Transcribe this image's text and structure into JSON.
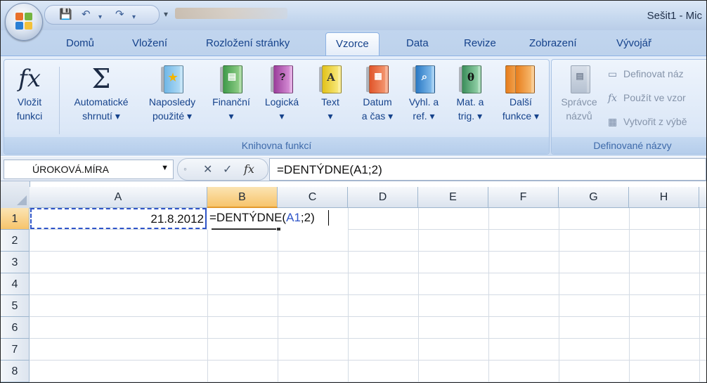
{
  "window": {
    "title": "Sešit1 - Mic",
    "blurred_title_region": true
  },
  "tabs": [
    {
      "label": "Domů",
      "active": false
    },
    {
      "label": "Vložení",
      "active": false
    },
    {
      "label": "Rozložení stránky",
      "active": false
    },
    {
      "label": "Vzorce",
      "active": true
    },
    {
      "label": "Data",
      "active": false
    },
    {
      "label": "Revize",
      "active": false
    },
    {
      "label": "Zobrazení",
      "active": false
    },
    {
      "label": "Vývojář",
      "active": false
    }
  ],
  "ribbon": {
    "group_library": "Knihovna funkcí",
    "group_names": "Definované názvy",
    "insert_function": {
      "line1": "Vložit",
      "line2": "funkci"
    },
    "autosum": {
      "line1": "Automatické",
      "line2": "shrnutí ▾"
    },
    "recent": {
      "line1": "Naposledy",
      "line2": "použité ▾"
    },
    "financial": {
      "line1": "Finanční",
      "line2": "▾"
    },
    "logical": {
      "line1": "Logická",
      "line2": "▾"
    },
    "text": {
      "line1": "Text",
      "line2": "▾"
    },
    "datetime": {
      "line1": "Datum",
      "line2": "a čas ▾"
    },
    "lookup": {
      "line1": "Vyhl. a",
      "line2": "ref. ▾"
    },
    "math": {
      "line1": "Mat. a",
      "line2": "trig. ▾"
    },
    "more": {
      "line1": "Další",
      "line2": "funkce ▾"
    },
    "name_manager": {
      "line1": "Správce",
      "line2": "názvů"
    },
    "define_name": "Definovat náz",
    "use_in_formula": "Použít ve vzor",
    "create_from_selection": "Vytvořit z výbě"
  },
  "formula_bar": {
    "name_box": "ÚROKOVÁ.MÍRA",
    "formula": "=DENTÝDNE(A1;2)"
  },
  "columns": [
    "A",
    "B",
    "C",
    "D",
    "E",
    "F",
    "G",
    "H"
  ],
  "rows": [
    "1",
    "2",
    "3",
    "4",
    "5",
    "6",
    "7",
    "8"
  ],
  "cells": {
    "A1": "21.8.2012",
    "B1_prefix": "=DENTÝDNE(",
    "B1_ref": "A1",
    "B1_suffix": ";2)"
  },
  "colors": {
    "reference_blue": "#2f55c8",
    "tab_text": "#15428b",
    "selected_header": "#f7c46b"
  }
}
